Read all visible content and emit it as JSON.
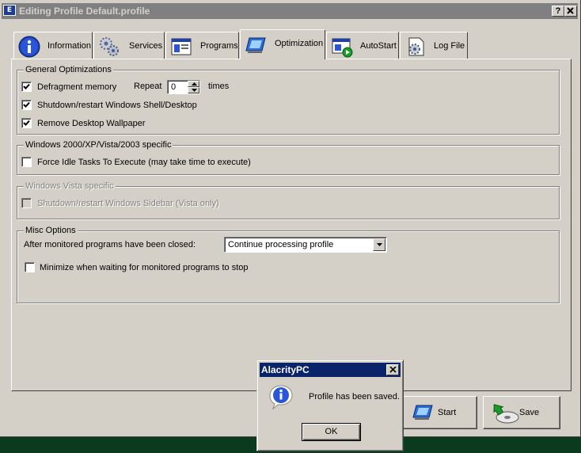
{
  "window": {
    "title": "Editing Profile Default.profile",
    "help_label": "?",
    "close_label": "✕"
  },
  "tabs": [
    {
      "label": "Information",
      "icon": "info-icon"
    },
    {
      "label": "Services",
      "icon": "gears-icon"
    },
    {
      "label": "Programs",
      "icon": "window-icon"
    },
    {
      "label": "Optimization",
      "icon": "optimization-icon",
      "active": true
    },
    {
      "label": "AutoStart",
      "icon": "autostart-icon"
    },
    {
      "label": "Log File",
      "icon": "log-file-icon"
    }
  ],
  "general": {
    "title": "General Optimizations",
    "defragment_label": "Defragment memory",
    "defragment_checked": true,
    "repeat_label": "Repeat",
    "repeat_value": "0",
    "times_label": "times",
    "shutdown_shell_label": "Shutdown/restart Windows Shell/Desktop",
    "shutdown_shell_checked": true,
    "wallpaper_label": "Remove Desktop Wallpaper",
    "wallpaper_checked": true
  },
  "win2000": {
    "title": "Windows 2000/XP/Vista/2003 specific",
    "idle_tasks_label": "Force Idle Tasks To Execute (may take time to execute)",
    "idle_tasks_checked": false
  },
  "vista": {
    "title": "Windows Vista specific",
    "sidebar_label": "Shutdown/restart Windows Sidebar (Vista only)",
    "sidebar_checked": false,
    "disabled": true
  },
  "misc": {
    "title": "Misc Options",
    "after_closed_label": "After monitored programs have been closed:",
    "after_closed_value": "Continue processing profile",
    "minimize_label": "Minimize when waiting for monitored programs to stop",
    "minimize_checked": false
  },
  "buttons": {
    "start_label": "Start",
    "save_label": "Save"
  },
  "dialog": {
    "title": "AlacrityPC",
    "message": "Profile has been saved.",
    "ok_label": "OK",
    "icon": "info-icon"
  },
  "colors": {
    "face": "#d4d0c8",
    "inactive_titlebar": "#808080",
    "active_titlebar": "#0a246a",
    "desktop": "#0b3a1e"
  }
}
